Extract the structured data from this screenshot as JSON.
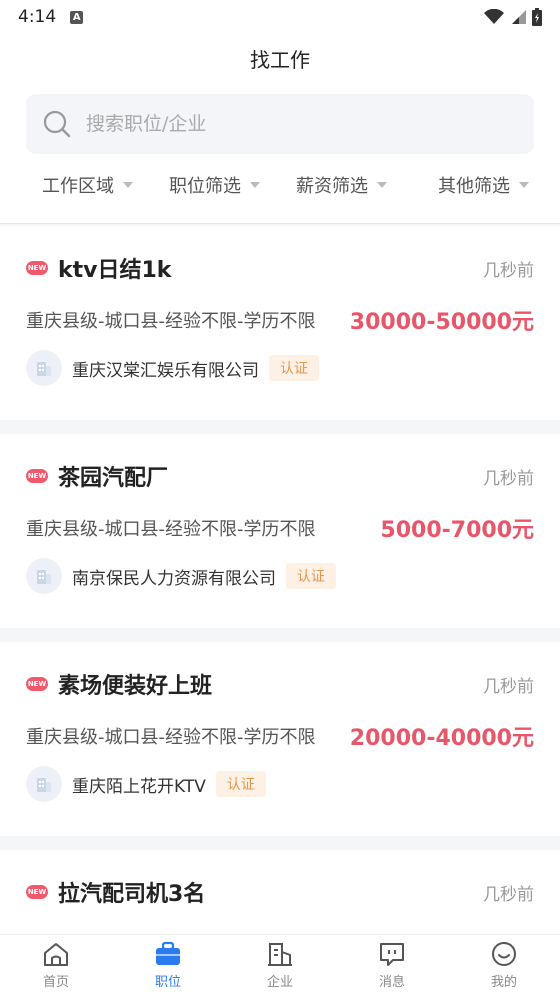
{
  "status": {
    "time": "4:14",
    "a_icon": "A"
  },
  "header": {
    "title": "找工作",
    "search_placeholder": "搜索职位/企业",
    "filters": [
      {
        "label": "工作区域"
      },
      {
        "label": "职位筛选"
      },
      {
        "label": "薪资筛选"
      },
      {
        "label": "其他筛选"
      }
    ]
  },
  "jobs": [
    {
      "badge": "NEW",
      "title": "ktv日结1k",
      "time": "几秒前",
      "requirements": "重庆县级-城口县-经验不限-学历不限",
      "salary": "30000-50000元",
      "company": "重庆汉棠汇娱乐有限公司",
      "cert": "认证"
    },
    {
      "badge": "NEW",
      "title": "茶园汽配厂",
      "time": "几秒前",
      "requirements": "重庆县级-城口县-经验不限-学历不限",
      "salary": "5000-7000元",
      "company": "南京保民人力资源有限公司",
      "cert": "认证"
    },
    {
      "badge": "NEW",
      "title": "素场便装好上班",
      "time": "几秒前",
      "requirements": "重庆县级-城口县-经验不限-学历不限",
      "salary": "20000-40000元",
      "company": "重庆陌上花开KTV",
      "cert": "认证"
    },
    {
      "badge": "NEW",
      "title": "拉汽配司机3名",
      "time": "几秒前",
      "requirements": "",
      "salary": "",
      "company": "",
      "cert": ""
    }
  ],
  "tabs": [
    {
      "label": "首页",
      "icon": "home-icon"
    },
    {
      "label": "职位",
      "icon": "briefcase-icon"
    },
    {
      "label": "企业",
      "icon": "building-icon"
    },
    {
      "label": "消息",
      "icon": "message-icon"
    },
    {
      "label": "我的",
      "icon": "smile-icon"
    }
  ],
  "colors": {
    "accent": "#2b7bf0",
    "salary": "#e8566a",
    "new_badge": "#ef5a6f",
    "cert": "#e8964a"
  }
}
